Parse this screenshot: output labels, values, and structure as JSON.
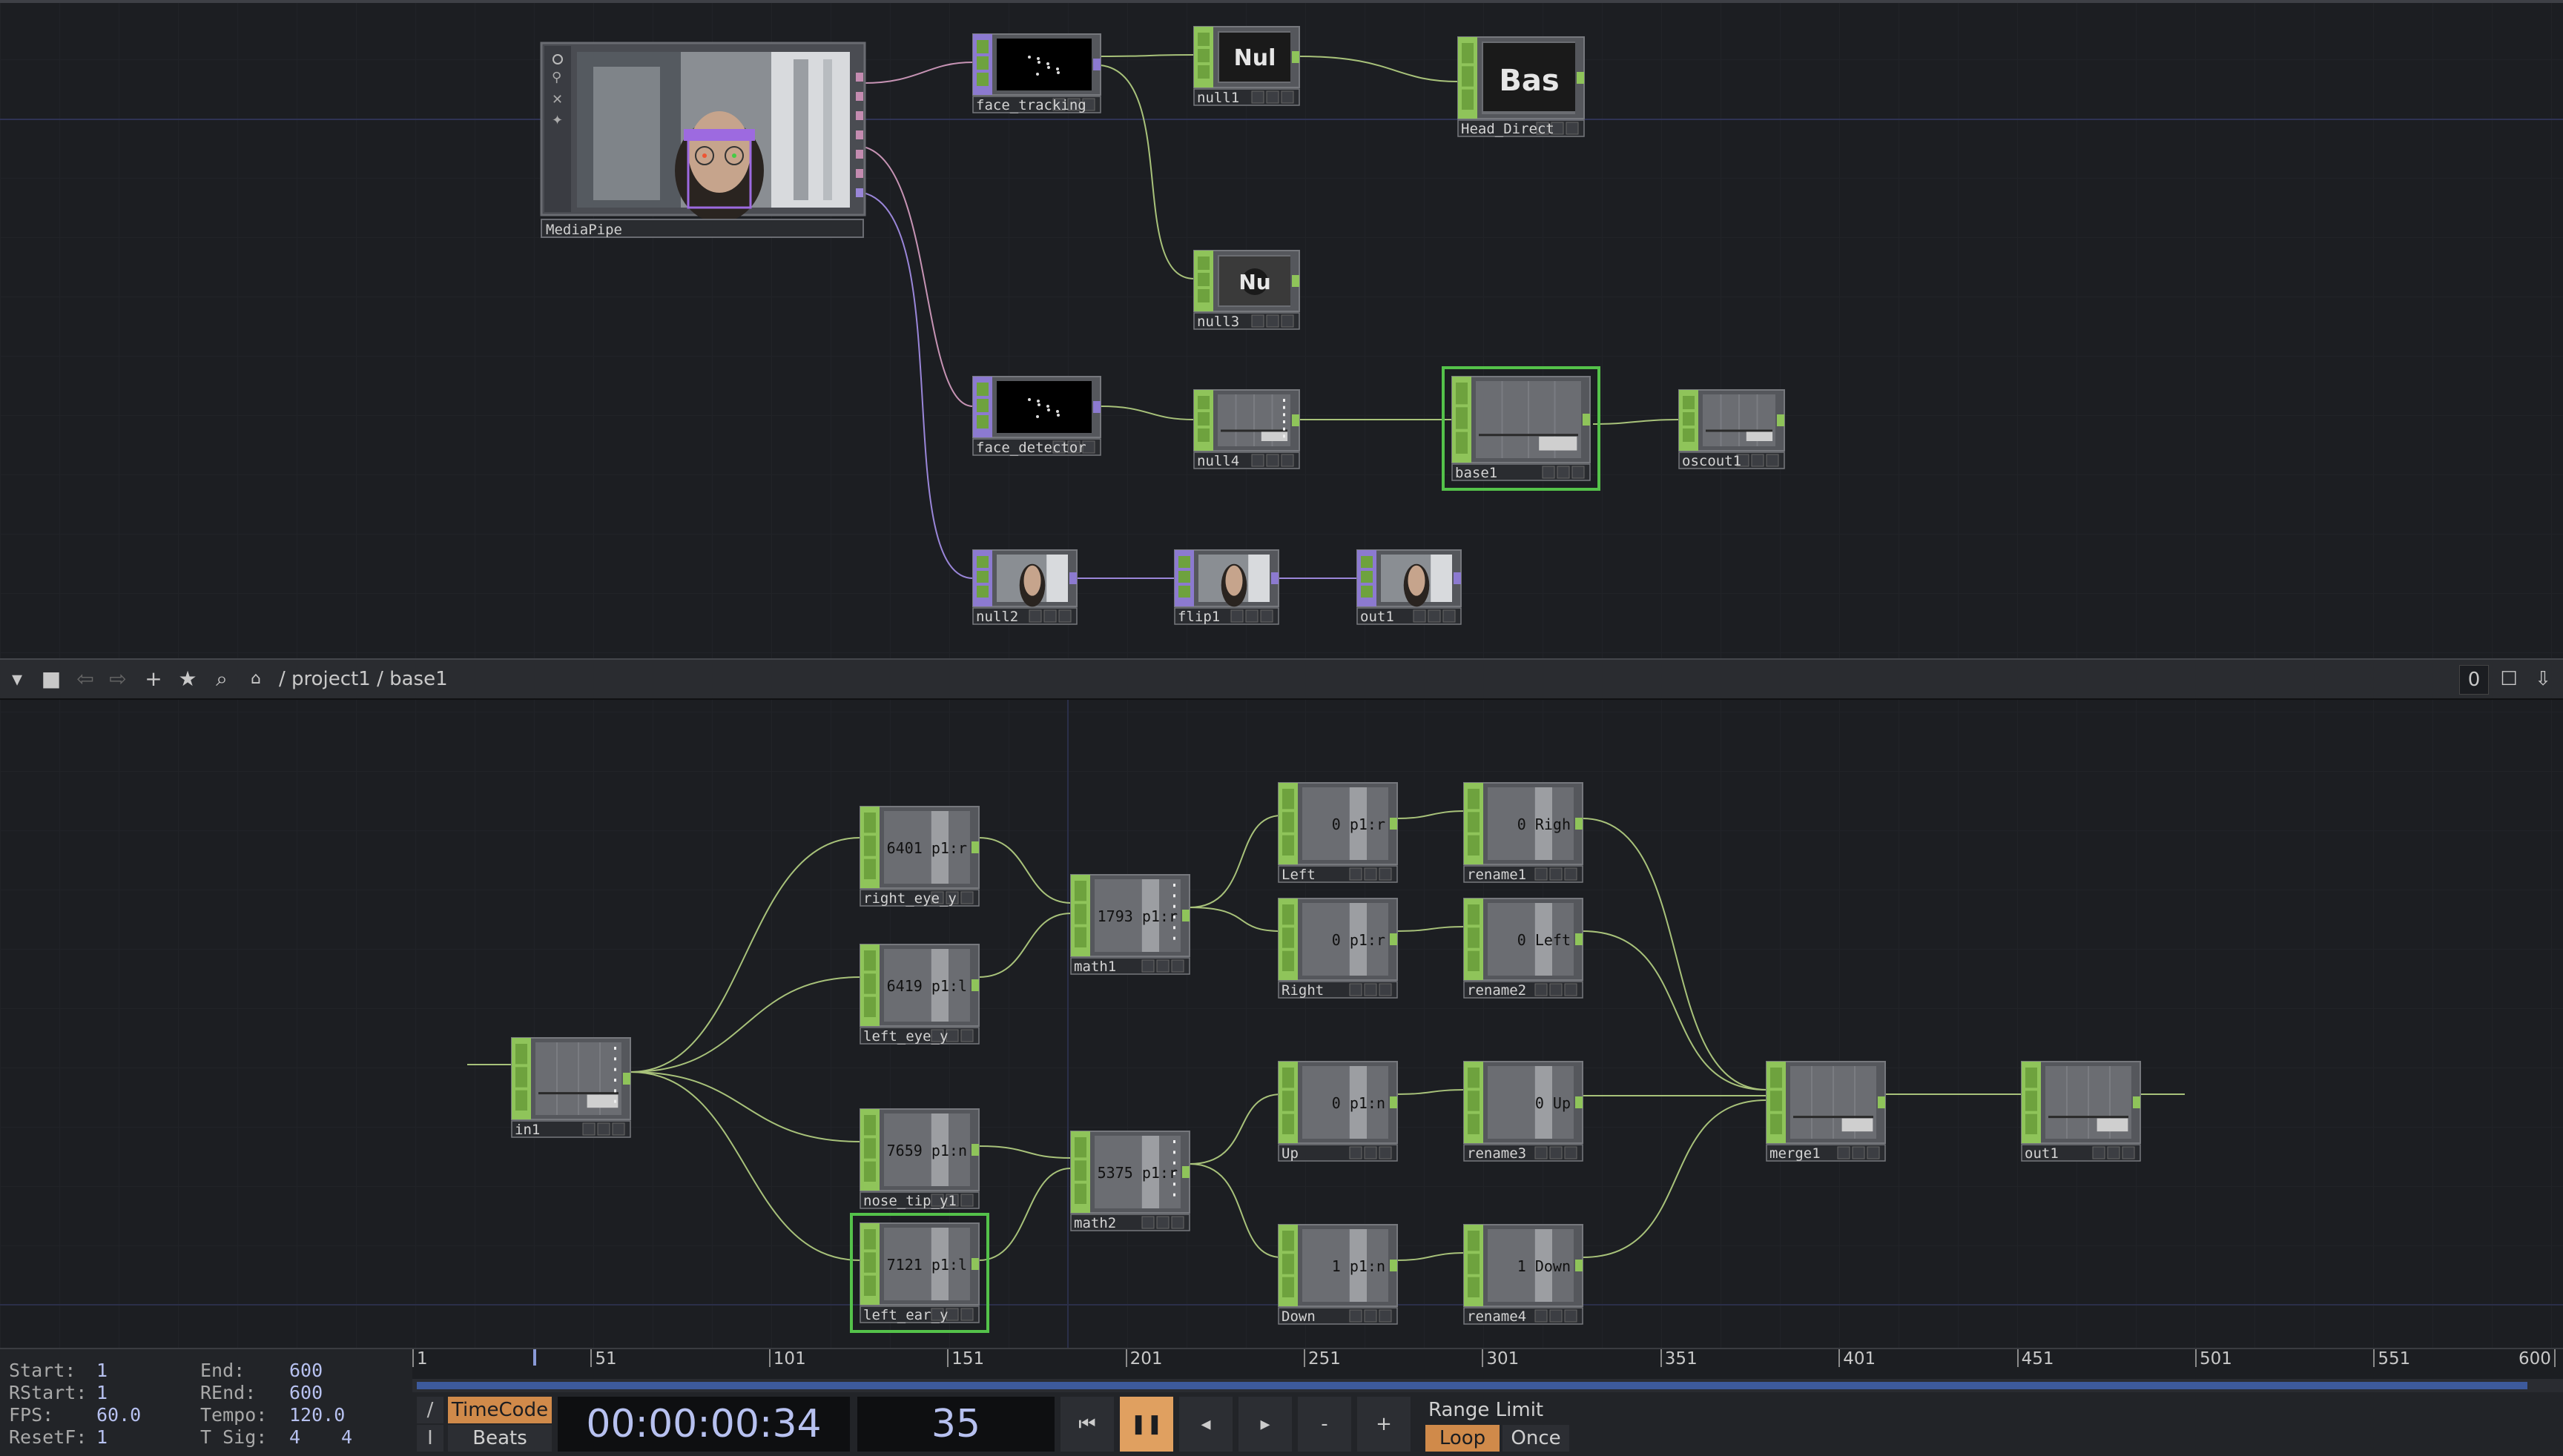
{
  "network": {
    "upper": {
      "nodes": {
        "mediapipe": "MediaPipe",
        "face_tracking": "face_tracking",
        "null1": "null1",
        "null1_preview": "Nul",
        "head_direct": "Head_Direct",
        "head_direct_preview": "Bas",
        "null3": "null3",
        "null3_preview": "Nu",
        "face_detector": "face_detector",
        "null4": "null4",
        "base1": "base1",
        "oscout1": "oscout1",
        "null2": "null2",
        "flip1": "flip1",
        "out1": "out1"
      }
    },
    "lower": {
      "nodes": {
        "in1": "in1",
        "right_eye_y": "right_eye_y",
        "right_eye_y_value": "6401 p1:r",
        "left_eye_y": "left_eye_y",
        "left_eye_y_value": "6419 p1:l",
        "nose_tip_y1": "nose_tip_y1",
        "nose_tip_y1_value": "7659 p1:n",
        "left_ear_y": "left_ear_y",
        "left_ear_y_value": "7121 p1:l",
        "math1": "math1",
        "math1_value": "1793 p1:r",
        "math2": "math2",
        "math2_value": "5375 p1:r",
        "left": "Left",
        "left_value": "0 p1:r",
        "right": "Right",
        "right_value": "0 p1:r",
        "up": "Up",
        "up_value": "0 p1:n",
        "down": "Down",
        "down_value": "1 p1:n",
        "rename1": "rename1",
        "rename1_value": "0 Righ",
        "rename2": "rename2",
        "rename2_value": "0 Left",
        "rename3": "rename3",
        "rename3_value": "0 Up",
        "rename4": "rename4",
        "rename4_value": "1 Down",
        "merge1": "merge1",
        "out1": "out1"
      }
    }
  },
  "pathbar": {
    "path": "/ project1 / base1",
    "counter": "0"
  },
  "timeline": {
    "ticks": [
      "1",
      "51",
      "101",
      "151",
      "201",
      "251",
      "301",
      "351",
      "401",
      "451",
      "501",
      "551",
      "600"
    ],
    "current_frame": 35
  },
  "bottom": {
    "start_label": "Start:",
    "start": "1",
    "end_label": "End:",
    "end": "600",
    "rstart_label": "RStart:",
    "rstart": "1",
    "rend_label": "REnd:",
    "rend": "600",
    "fps_label": "FPS:",
    "fps": "60.0",
    "tempo_label": "Tempo:",
    "tempo": "120.0",
    "resetf_label": "ResetF:",
    "resetf": "1",
    "tsig_label": "T Sig:",
    "tsig_a": "4",
    "tsig_b": "4",
    "timecode_label": "TimeCode",
    "beats_label": "Beats",
    "timecode": "00:00:00:34",
    "frame": "35",
    "range_limit_label": "Range Limit",
    "loop_label": "Loop",
    "once_label": "Once",
    "minus_label": "-",
    "plus_label": "+",
    "slash_label": "/",
    "i_label": "I"
  },
  "colors": {
    "background": "#1b1d21",
    "chop": "#8fc45a",
    "top": "#8c7ad0",
    "wire_chop": "#a8c27a",
    "wire_top": "#9a86d9",
    "active_orange": "#e0a060",
    "timecode_text": "#b7c1f0"
  }
}
